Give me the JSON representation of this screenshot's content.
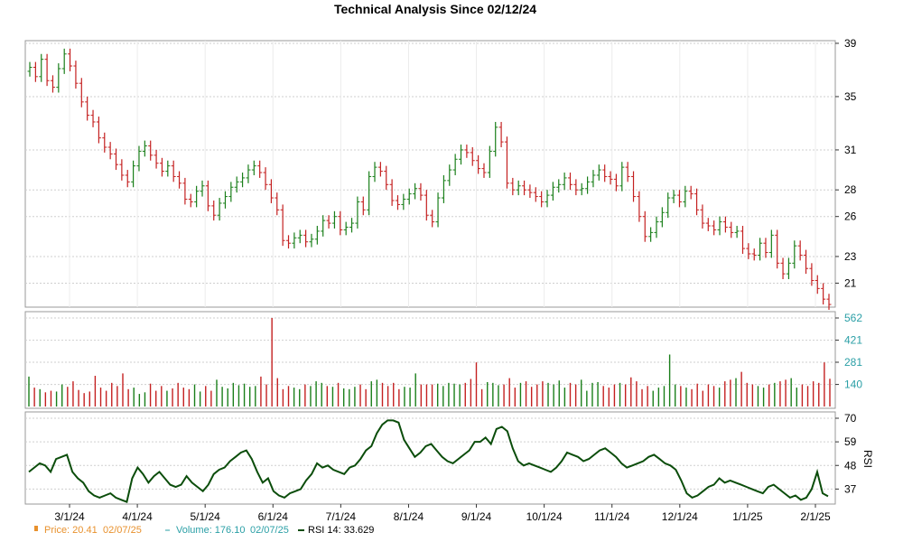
{
  "chart_data": {
    "type": "candlestick-volume-rsi",
    "title": "Technical Analysis Since 02/12/24",
    "colors": {
      "up": "#1a7f1a",
      "down": "#c42020",
      "volume_axis": "#2a9fa6",
      "rsi_line": "#0b4d0b",
      "legend_price": "#e8912d",
      "legend_volume": "#2a9fa6"
    },
    "x_tick_labels": [
      "3/1/24",
      "4/1/24",
      "5/1/24",
      "6/1/24",
      "7/1/24",
      "8/1/24",
      "9/1/24",
      "10/1/24",
      "11/1/24",
      "12/1/24",
      "1/1/25",
      "2/1/25"
    ],
    "price_panel": {
      "y_tick_labels": [
        "39",
        "35",
        "31",
        "28",
        "26",
        "23",
        "21"
      ],
      "ylim": [
        19.2,
        39.2
      ],
      "closes": [
        37.2,
        36.5,
        37.8,
        36.2,
        35.7,
        37.1,
        38.2,
        37.3,
        36.0,
        34.6,
        33.6,
        33.1,
        31.9,
        31.2,
        30.7,
        29.9,
        29.1,
        28.6,
        29.8,
        30.9,
        31.3,
        30.6,
        30.0,
        29.4,
        29.8,
        29.0,
        28.5,
        27.3,
        27.1,
        27.9,
        28.3,
        26.8,
        26.1,
        27.0,
        27.5,
        28.2,
        28.6,
        28.9,
        29.5,
        29.8,
        29.3,
        28.4,
        27.4,
        26.5,
        24.2,
        24.0,
        24.4,
        24.6,
        24.1,
        24.3,
        24.9,
        25.7,
        25.5,
        26.0,
        25.0,
        25.2,
        25.5,
        27.1,
        26.5,
        29.0,
        29.7,
        29.4,
        28.4,
        27.2,
        26.9,
        27.3,
        27.7,
        28.1,
        27.6,
        26.1,
        25.6,
        27.4,
        28.7,
        29.5,
        30.3,
        31.0,
        30.8,
        30.2,
        29.6,
        29.3,
        30.9,
        32.7,
        31.6,
        28.5,
        28.0,
        28.3,
        28.0,
        27.8,
        27.5,
        27.1,
        27.6,
        28.2,
        28.4,
        28.9,
        28.4,
        28.0,
        28.1,
        28.6,
        29.1,
        29.5,
        29.0,
        28.8,
        28.3,
        29.7,
        29.0,
        27.5,
        26.0,
        24.5,
        24.8,
        25.6,
        26.3,
        27.4,
        27.6,
        27.1,
        27.9,
        27.7,
        26.5,
        25.5,
        25.3,
        25.0,
        25.6,
        25.2,
        24.8,
        24.9,
        23.6,
        23.2,
        23.1,
        24.0,
        23.3,
        24.6,
        22.5,
        21.7,
        22.5,
        23.8,
        23.1,
        22.1,
        21.2,
        20.6,
        19.8,
        19.4
      ]
    },
    "volume_panel": {
      "y_tick_labels": [
        "562",
        "421",
        "281",
        "140"
      ],
      "ylim": [
        0,
        562
      ],
      "values": [
        190,
        120,
        110,
        90,
        100,
        95,
        140,
        125,
        160,
        105,
        85,
        95,
        195,
        120,
        100,
        150,
        130,
        210,
        110,
        120,
        80,
        90,
        145,
        100,
        130,
        100,
        115,
        150,
        120,
        110,
        140,
        95,
        130,
        100,
        170,
        125,
        115,
        150,
        135,
        145,
        125,
        130,
        190,
        140,
        562,
        180,
        110,
        130,
        120,
        110,
        140,
        130,
        160,
        150,
        130,
        125,
        150,
        115,
        110,
        125,
        140,
        110,
        160,
        170,
        150,
        130,
        150,
        110,
        125,
        120,
        210,
        140,
        140,
        140,
        145,
        130,
        150,
        145,
        140,
        150,
        175,
        280,
        110,
        155,
        150,
        135,
        140,
        180,
        120,
        150,
        160,
        125,
        140,
        160,
        150,
        140,
        165,
        120,
        150,
        140,
        170,
        100,
        150,
        155,
        130,
        120,
        140,
        150,
        140,
        185,
        160,
        110,
        130,
        100,
        120,
        130,
        330,
        140,
        130,
        120,
        110,
        145,
        100,
        140,
        130,
        120,
        160,
        170,
        180,
        220,
        150,
        140,
        130,
        120,
        140,
        150,
        160,
        170,
        180,
        120,
        140,
        130,
        160,
        150,
        280,
        176.1
      ]
    },
    "rsi_panel": {
      "y_tick_labels": [
        "70",
        "59",
        "48",
        "37"
      ],
      "ylim": [
        30,
        70
      ],
      "values": [
        45,
        47,
        49,
        48,
        45,
        51,
        52,
        53,
        45,
        42,
        40,
        36,
        34,
        33,
        34,
        35,
        33,
        32,
        31,
        42,
        47,
        44,
        40,
        43,
        45,
        42,
        39,
        38,
        39,
        43,
        40,
        38,
        36,
        39,
        44,
        46,
        47,
        50,
        52,
        54,
        55,
        51,
        45,
        40,
        42,
        36,
        34,
        33,
        35,
        36,
        37,
        41,
        44,
        49,
        47,
        48,
        46,
        45,
        44,
        47,
        48,
        51,
        55,
        57,
        63,
        67,
        69,
        69,
        68,
        60,
        56,
        52,
        54,
        57,
        58,
        55,
        52,
        50,
        49,
        51,
        53,
        55,
        59,
        59,
        61,
        58,
        65,
        66,
        64,
        56,
        50,
        48,
        49,
        48,
        47,
        46,
        45,
        47,
        50,
        54,
        53,
        52,
        50,
        51,
        53,
        55,
        56,
        54,
        52,
        49,
        47,
        48,
        49,
        50,
        52,
        53,
        51,
        49,
        48,
        46,
        41,
        35,
        33,
        34,
        36,
        38,
        39,
        42,
        40,
        41,
        40,
        39,
        38,
        37,
        36,
        35,
        38,
        39,
        37,
        35,
        33,
        34,
        32,
        33,
        37,
        45,
        35,
        33.629
      ]
    },
    "legend": {
      "price_label": "Price: 20.41",
      "price_date": "02/07/25",
      "volume_label": "Volume: 176.10",
      "volume_date": "02/07/25",
      "rsi_label": "RSI 14: 33.629"
    },
    "rsi_axis_label": "RSI"
  }
}
